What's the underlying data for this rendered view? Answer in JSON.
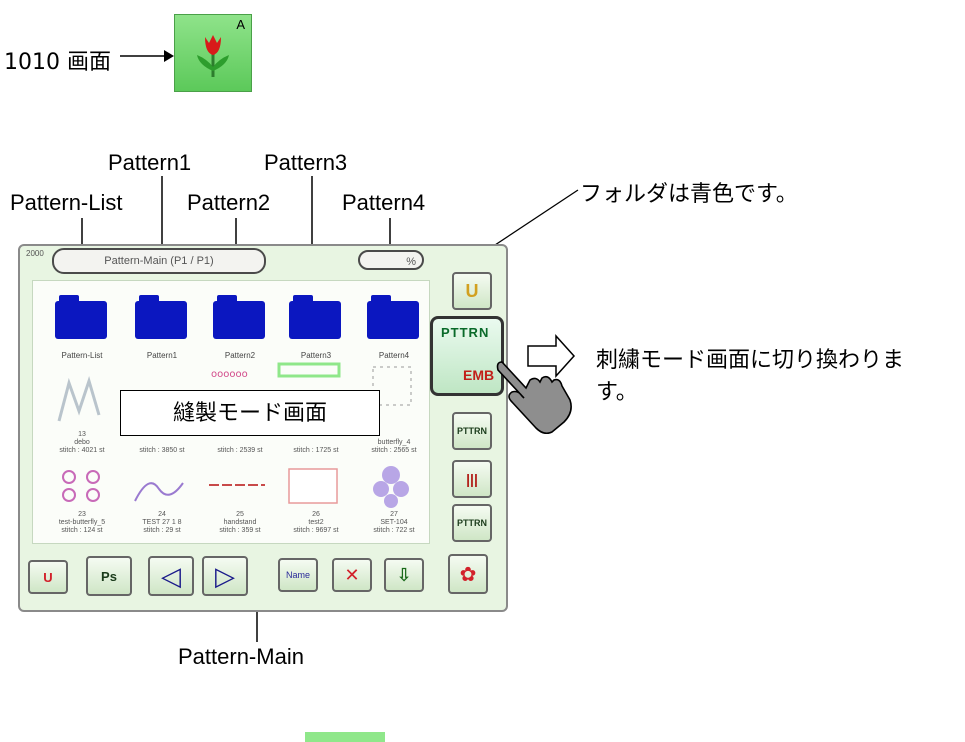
{
  "top": {
    "label": "1010 画面",
    "icon_name": "tulip-icon",
    "icon_superscript": "A"
  },
  "callouts": {
    "pattern1": "Pattern1",
    "pattern3": "Pattern3",
    "pattern_list": "Pattern-List",
    "pattern2": "Pattern2",
    "pattern4": "Pattern4",
    "folder_note": "フォルダは青色です。",
    "switch_note_line1": "刺繍モード画面に切り換わりま",
    "switch_note_line2": "す。",
    "sewing_mode": "縫製モード画面",
    "pattern_main": "Pattern-Main"
  },
  "panel": {
    "number": "2000",
    "title": "Pattern-Main (P1 / P1)",
    "percent": "%",
    "folders": [
      {
        "name": "Pattern-List"
      },
      {
        "name": "Pattern1"
      },
      {
        "name": "Pattern2"
      },
      {
        "name": "Pattern3"
      },
      {
        "name": "Pattern4"
      }
    ],
    "row2": [
      {
        "line1": "13",
        "line2": "debo",
        "line3": "stitch : 4021 st"
      },
      {
        "line1": "",
        "line2": "",
        "line3": "stitch : 3850 st"
      },
      {
        "line1": "",
        "line2": "",
        "line3": "stitch : 2539 st"
      },
      {
        "line1": "",
        "line2": "",
        "line3": "stitch : 1725 st"
      },
      {
        "line1": "",
        "line2": "butterfly_4",
        "line3": "stitch : 2565 st"
      }
    ],
    "row3": [
      {
        "line1": "23",
        "line2": "test-butterfly_5",
        "line3": "stitch : 124 st"
      },
      {
        "line1": "24",
        "line2": "TEST 27 1 8",
        "line3": "stitch : 29 st"
      },
      {
        "line1": "25",
        "line2": "handstand",
        "line3": "stitch : 359 st"
      },
      {
        "line1": "26",
        "line2": "test2",
        "line3": "stitch : 9697 st"
      },
      {
        "line1": "27",
        "line2": "SET-104",
        "line3": "stitch : 722 st"
      }
    ],
    "bottom_buttons": [
      {
        "name": "magnet-icon",
        "label": "U"
      },
      {
        "name": "pattern-select-icon",
        "label": "Ps"
      },
      {
        "name": "prev-page-icon",
        "label": "◁"
      },
      {
        "name": "next-page-icon",
        "label": "▷"
      },
      {
        "name": "name-icon",
        "label": "Name"
      },
      {
        "name": "delete-icon",
        "label": "✕"
      },
      {
        "name": "usb-icon",
        "label": "⇩"
      },
      {
        "name": "tulip-icon",
        "label": "✿"
      }
    ],
    "side_buttons": [
      {
        "name": "magnet-icon",
        "label": "U"
      },
      {
        "name": "pattern-icon",
        "label": "PTTRN"
      },
      {
        "name": "thread-icon",
        "label": "|||"
      },
      {
        "name": "pattern-edit-icon",
        "label": "PTTRN"
      }
    ],
    "emb_button": {
      "line1": "PTTRN",
      "line2": "EMB"
    }
  }
}
